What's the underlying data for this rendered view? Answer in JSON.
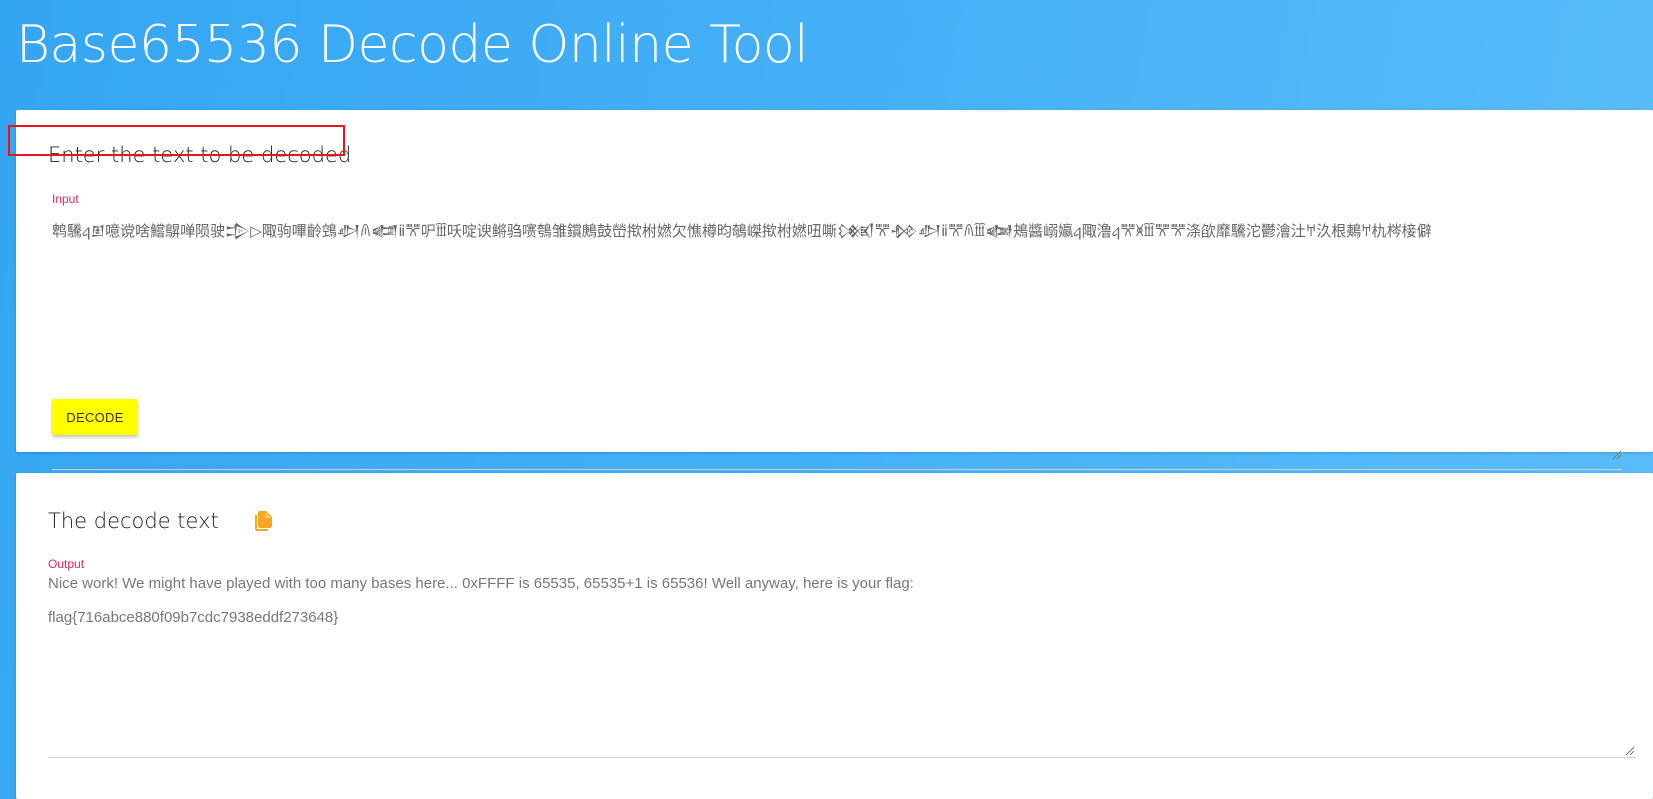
{
  "page": {
    "title": "Base65536 Decode Online Tool"
  },
  "input_card": {
    "title": "Enter the text to be decoded",
    "label": "Input",
    "value": "鹎驣𐔔𒁳噫谠啥鱨鵿啴陨驶𒄠▷陬驹嗶齡鵼𒀠𐀴𒅡ⅱ𐘩㕧𐘪㕭啶谀鳉驺㗷鴮雏鑜鶊鼓嵤揿柎㜣欠憔樽昀鵸嵥揿柎㜣吜嘶𒁸𐘩𒁵𒀠ⅱ𐘩𐀴𐘪𒅲鴂醬嵶㜲𐔔陬澛𐔔𐘩𐘨𐘪𐘩𐘩涤欿靡驣沱鬱澮汢𐀀汣根鴺𐀀朹梣椄僻",
    "button_label": "DECODE"
  },
  "output_card": {
    "title": "The decode text",
    "label": "Output",
    "line1": "Nice work! We might have played with too many bases here... 0xFFFF is 65535, 65535+1 is 65536! Well anyway, here is your flag:",
    "flag": "flag{716abce880f09b7cdc7938eddf273648}"
  },
  "colors": {
    "background_start": "#35a6f3",
    "background_end": "#5bbefa",
    "button": "#ffff00",
    "label": "#e0265b",
    "copy_icon": "#f5a623",
    "highlight": "#e8141e"
  },
  "icons": {
    "copy": "copy-icon",
    "resize": "resize-grip-icon"
  }
}
